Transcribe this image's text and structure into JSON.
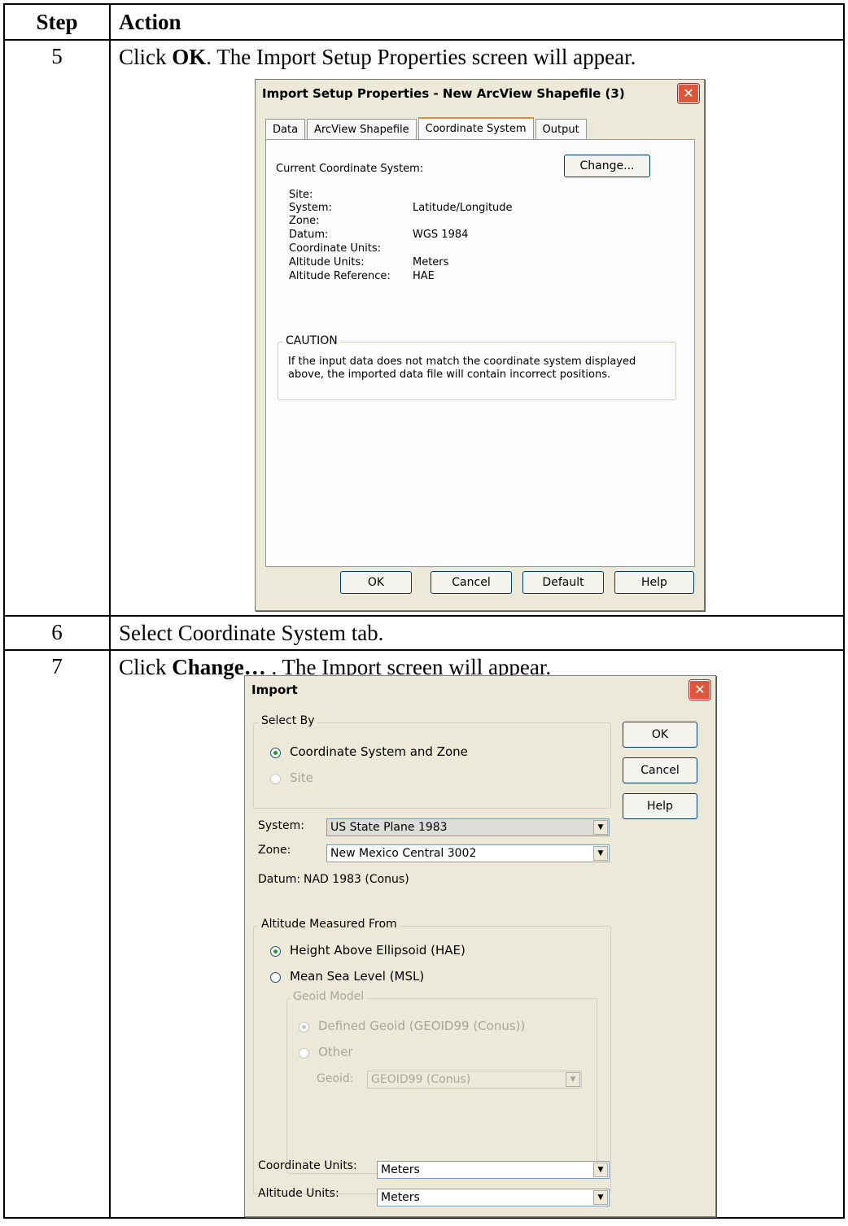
{
  "table": {
    "headers": [
      "Step",
      "Action"
    ],
    "rows": [
      {
        "step": "5",
        "before": "Click ",
        "bold": "OK",
        "after": ".  The Import Setup Properties screen will appear."
      },
      {
        "step": "6",
        "text": "Select Coordinate System tab."
      },
      {
        "step": "7",
        "before": "Click ",
        "bold": "Change…",
        "after": " .  The Import screen will appear."
      }
    ]
  },
  "dialog1": {
    "title": "Import Setup Properties - New ArcView Shapefile (3)",
    "tabs": [
      "Data",
      "ArcView Shapefile",
      "Coordinate System",
      "Output"
    ],
    "active_tab": "Coordinate System",
    "current_label": "Current Coordinate System:",
    "change_button": "Change...",
    "fields": [
      {
        "label": "Site:",
        "value": ""
      },
      {
        "label": "System:",
        "value": "Latitude/Longitude"
      },
      {
        "label": "Zone:",
        "value": ""
      },
      {
        "label": "Datum:",
        "value": "WGS 1984"
      },
      {
        "label": "Coordinate Units:",
        "value": ""
      },
      {
        "label": "Altitude Units:",
        "value": "Meters"
      },
      {
        "label": "Altitude Reference:",
        "value": "HAE"
      }
    ],
    "caution_title": "CAUTION",
    "caution_line1": "If the input data does not match the coordinate system displayed",
    "caution_line2": "above, the imported data file will contain incorrect positions.",
    "buttons": {
      "ok": "OK",
      "cancel": "Cancel",
      "default": "Default",
      "help": "Help"
    }
  },
  "dialog2": {
    "title": "Import",
    "select_by": "Select By",
    "opt_coord": "Coordinate System and Zone",
    "opt_site": "Site",
    "buttons": {
      "ok": "OK",
      "cancel": "Cancel",
      "help": "Help"
    },
    "system_label": "System:",
    "system_value": "US State Plane 1983",
    "zone_label": "Zone:",
    "zone_value": "New Mexico Central 3002",
    "datum_label": "Datum:",
    "datum_value": "NAD 1983 (Conus)",
    "altitude_group": "Altitude Measured From",
    "opt_hae": "Height Above Ellipsoid (HAE)",
    "opt_msl": "Mean Sea Level (MSL)",
    "geoid_group": "Geoid Model",
    "opt_defined": "Defined Geoid (GEOID99 (Conus))",
    "opt_other": "Other",
    "geoid_label": "Geoid:",
    "geoid_value": "GEOID99 (Conus)",
    "coord_units_label": "Coordinate Units:",
    "coord_units_value": "Meters",
    "alt_units_label": "Altitude Units:",
    "alt_units_value": "Meters"
  }
}
